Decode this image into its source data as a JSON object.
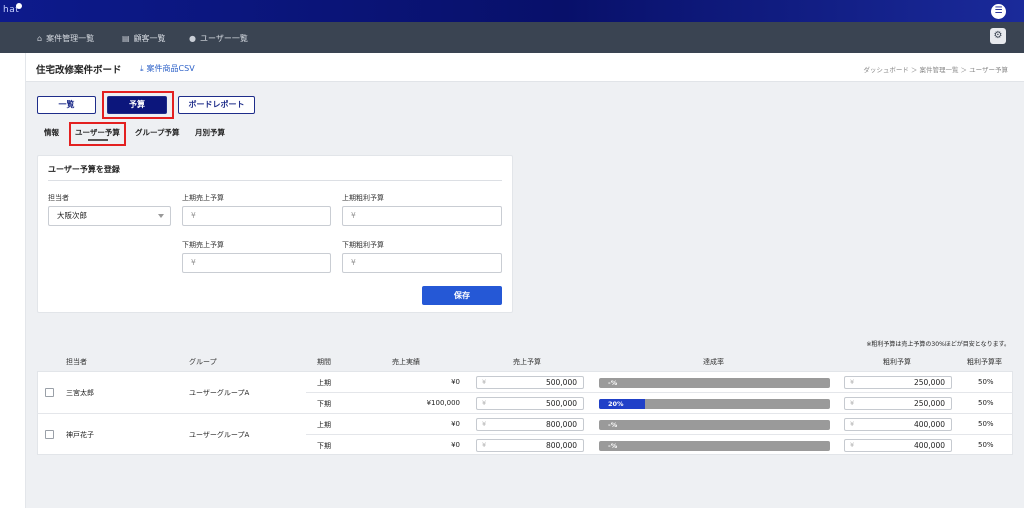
{
  "app": {
    "logo": "hat"
  },
  "nav": {
    "items": [
      {
        "label": "案件管理一覧",
        "icon": "home-icon"
      },
      {
        "label": "顧客一覧",
        "icon": "document-icon"
      },
      {
        "label": "ユーザー一覧",
        "icon": "user-icon"
      }
    ]
  },
  "header": {
    "title": "住宅改修案件ボード",
    "csv_link": "案件商品CSV",
    "breadcrumb": "ダッシュボード ＞ 案件管理一覧 ＞ ユーザー予算"
  },
  "view_buttons": {
    "list": "一覧",
    "budget": "予算",
    "report": "ボードレポート"
  },
  "subtabs": {
    "info": "情報",
    "user_budget": "ユーザー予算",
    "group_budget": "グループ予算",
    "monthly_budget": "月別予算"
  },
  "form": {
    "title": "ユーザー予算を登録",
    "assignee_label": "担当者",
    "assignee_value": "大阪次郎",
    "h1_sales_label": "上期売上予算",
    "h1_profit_label": "上期粗利予算",
    "h2_sales_label": "下期売上予算",
    "h2_profit_label": "下期粗利予算",
    "yen_placeholder": "¥",
    "save_label": "保存"
  },
  "note": "※粗利予算は売上予算の30%ほどが目安となります。",
  "table": {
    "headers": {
      "assignee": "担当者",
      "group": "グループ",
      "period": "期間",
      "actual": "売上実績",
      "sales_budget": "売上予算",
      "achievement": "達成率",
      "profit_budget": "粗利予算",
      "profit_rate": "粗利予算率"
    },
    "yen": "¥",
    "users": [
      {
        "name": "三宮太郎",
        "group": "ユーザーグループA",
        "rows": [
          {
            "period": "上期",
            "actual": "¥0",
            "sales_budget": "500,000",
            "achievement_label": "-%",
            "achievement": 0,
            "profit_budget": "250,000",
            "profit_rate": "50%"
          },
          {
            "period": "下期",
            "actual": "¥100,000",
            "sales_budget": "500,000",
            "achievement_label": "20%",
            "achievement": 0.2,
            "profit_budget": "250,000",
            "profit_rate": "50%"
          }
        ]
      },
      {
        "name": "神戸花子",
        "group": "ユーザーグループA",
        "rows": [
          {
            "period": "上期",
            "actual": "¥0",
            "sales_budget": "800,000",
            "achievement_label": "-%",
            "achievement": 0,
            "profit_budget": "400,000",
            "profit_rate": "50%"
          },
          {
            "period": "下期",
            "actual": "¥0",
            "sales_budget": "800,000",
            "achievement_label": "-%",
            "achievement": 0,
            "profit_budget": "400,000",
            "profit_rate": "50%"
          }
        ]
      }
    ]
  }
}
